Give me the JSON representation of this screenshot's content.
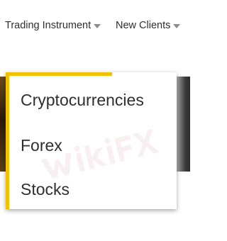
{
  "nav": {
    "items": [
      {
        "label": "Trading Instrument",
        "icon": "chevron-down-icon"
      },
      {
        "label": "New Clients",
        "icon": "chevron-down-icon"
      }
    ]
  },
  "dropdown": {
    "accent_color": "#f2c100",
    "items": [
      {
        "label": "Cryptocurrencies"
      },
      {
        "label": "Forex"
      },
      {
        "label": "Stocks"
      }
    ]
  },
  "watermark": {
    "brand": "WikiFX",
    "color": "#d8a7a7"
  }
}
